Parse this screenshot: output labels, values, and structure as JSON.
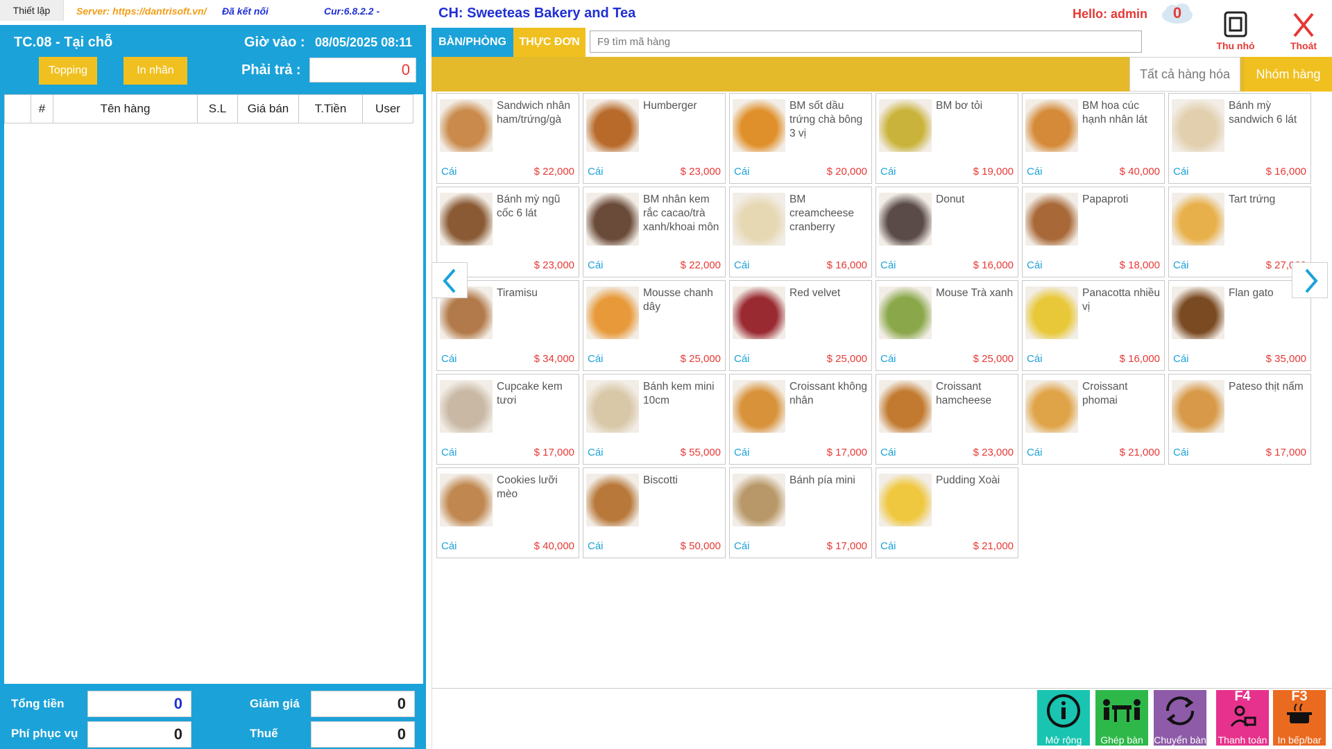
{
  "topbar": {
    "setup_label": "Thiết lập",
    "server": "Server: https://dantrisoft.vn/",
    "connection": "Đã kết nối",
    "version": "Cur:6.8.2.2 -"
  },
  "order_panel": {
    "table_name": "TC.08 - Tại chỗ",
    "checkin_label": "Giờ vào :",
    "checkin_value": "08/05/2025 08:11",
    "topping_label": "Topping",
    "print_label_label": "In nhãn",
    "pay_label": "Phải trả :",
    "pay_value": "0",
    "columns": [
      "",
      "#",
      "Tên hàng",
      "S.L",
      "Giá bán",
      "T.Tiền",
      "User"
    ],
    "footer": {
      "total_label": "Tổng tiền",
      "total_value": "0",
      "discount_label": "Giảm giá",
      "discount_value": "0",
      "service_label": "Phí phục vụ",
      "service_value": "0",
      "tax_label": "Thuế",
      "tax_value": "0"
    }
  },
  "header": {
    "store_title": "CH: Sweeteas Bakery and Tea",
    "hello": "Hello: admin",
    "notification_count": "0",
    "minimize_label": "Thu nhỏ",
    "exit_label": "Thoát"
  },
  "tabs": {
    "table_room": "BÀN/PHÒNG",
    "menu": "THỰC ĐƠN",
    "search_placeholder": "F9 tìm mã hàng"
  },
  "group_bar": {
    "all_label": "Tất cả hàng hóa",
    "group_label": "Nhóm hàng"
  },
  "products": [
    {
      "name": "Sandwich nhân ham/trứng/gà",
      "unit": "Cái",
      "price": "$ 22,000",
      "color": "#c98a4b"
    },
    {
      "name": "Humberger",
      "unit": "Cái",
      "price": "$ 23,000",
      "color": "#b86a2a"
    },
    {
      "name": "BM sốt dầu trứng chà bông 3 vị",
      "unit": "Cái",
      "price": "$ 20,000",
      "color": "#e0902a"
    },
    {
      "name": "BM bơ tỏi",
      "unit": "Cái",
      "price": "$ 19,000",
      "color": "#c9b33a"
    },
    {
      "name": "BM hoa cúc hạnh nhân lát",
      "unit": "Cái",
      "price": "$ 40,000",
      "color": "#d48a38"
    },
    {
      "name": "Bánh mỳ sandwich 6 lát",
      "unit": "Cái",
      "price": "$ 16,000",
      "color": "#e2cfae"
    },
    {
      "name": "Bánh mỳ ngũ cốc 6 lát",
      "unit": "",
      "price": "$ 23,000",
      "color": "#8a5a34"
    },
    {
      "name": "BM nhân kem rắc cacao/trà xanh/khoai môn",
      "unit": "Cái",
      "price": "$ 22,000",
      "color": "#6a4a38"
    },
    {
      "name": "BM creamcheese cranberry",
      "unit": "Cái",
      "price": "$ 16,000",
      "color": "#e7d8b4"
    },
    {
      "name": "Donut",
      "unit": "Cái",
      "price": "$ 16,000",
      "color": "#5a4a48"
    },
    {
      "name": "Papaproti",
      "unit": "Cái",
      "price": "$ 18,000",
      "color": "#a86838"
    },
    {
      "name": "Tart trứng",
      "unit": "Cái",
      "price": "$ 27,000",
      "color": "#e8b04a"
    },
    {
      "name": "Tiramisu",
      "unit": "Cái",
      "price": "$ 34,000",
      "color": "#b27a4a"
    },
    {
      "name": "Mousse chanh dây",
      "unit": "Cái",
      "price": "$ 25,000",
      "color": "#e89a3a"
    },
    {
      "name": "Red velvet",
      "unit": "Cái",
      "price": "$ 25,000",
      "color": "#9a2a32"
    },
    {
      "name": "Mouse Trà xanh",
      "unit": "Cái",
      "price": "$ 25,000",
      "color": "#8aa84a"
    },
    {
      "name": "Panacotta nhiều vị",
      "unit": "Cái",
      "price": "$ 16,000",
      "color": "#e8c838"
    },
    {
      "name": "Flan gato",
      "unit": "Cái",
      "price": "$ 35,000",
      "color": "#7a4a22"
    },
    {
      "name": "Cupcake kem tươi",
      "unit": "Cái",
      "price": "$ 17,000",
      "color": "#c8b8a4"
    },
    {
      "name": "Bánh kem mini 10cm",
      "unit": "Cái",
      "price": "$ 55,000",
      "color": "#d8c8a8"
    },
    {
      "name": "Croissant không nhân",
      "unit": "Cái",
      "price": "$ 17,000",
      "color": "#d8923a"
    },
    {
      "name": "Croissant hamcheese",
      "unit": "Cái",
      "price": "$ 23,000",
      "color": "#c27a30"
    },
    {
      "name": "Croissant phomai",
      "unit": "Cái",
      "price": "$ 21,000",
      "color": "#e0a448"
    },
    {
      "name": "Pateso thịt nấm",
      "unit": "Cái",
      "price": "$ 17,000",
      "color": "#d89a48"
    },
    {
      "name": "Cookies lưỡi mèo",
      "unit": "Cái",
      "price": "$ 40,000",
      "color": "#c08850"
    },
    {
      "name": "Biscotti",
      "unit": "Cái",
      "price": "$ 50,000",
      "color": "#b8783a"
    },
    {
      "name": "Bánh pía mini",
      "unit": "Cái",
      "price": "$ 17,000",
      "color": "#b89868"
    },
    {
      "name": "Pudding Xoài",
      "unit": "Cái",
      "price": "$ 21,000",
      "color": "#f0c840"
    }
  ],
  "actions": {
    "more": "Mở rộng",
    "merge": "Ghép bàn",
    "transfer": "Chuyển bàn",
    "pay": "Thanh toán",
    "pay_key": "F4",
    "kitchen": "In bếp/bar",
    "kitchen_key": "F3"
  }
}
